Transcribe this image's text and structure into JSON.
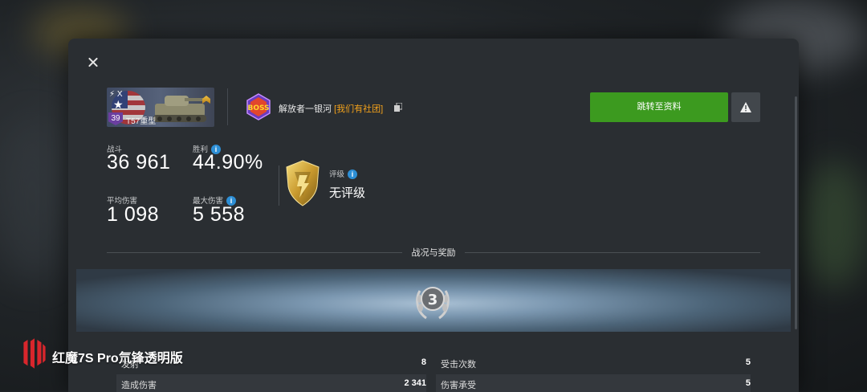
{
  "dialog": {
    "close_label": ""
  },
  "tank": {
    "tier_top": "X",
    "tier": "39",
    "name": "T57重型"
  },
  "player": {
    "name": "解放者一银河",
    "clan": "[我们有社团]",
    "boss_text": "BOSS"
  },
  "actions": {
    "goto_profile": "跳转至资料"
  },
  "stats": {
    "battles": {
      "label": "战斗",
      "value": "36 961"
    },
    "winrate": {
      "label": "胜利",
      "value": "44.90%"
    },
    "avg_damage": {
      "label": "平均伤害",
      "value": "1 098"
    },
    "max_damage": {
      "label": "最大伤害",
      "value": "5 558"
    }
  },
  "rating": {
    "label": "评级",
    "value": "无评级"
  },
  "section": {
    "title": "战况与奖励",
    "badge": "3"
  },
  "details": [
    {
      "label": "发射",
      "value": "8"
    },
    {
      "label": "受击次数",
      "value": "5"
    },
    {
      "label": "造成伤害",
      "value": "2 341"
    },
    {
      "label": "伤害承受",
      "value": "5"
    }
  ],
  "watermark": {
    "text": "红魔7S Pro氘锋透明版"
  },
  "colors": {
    "accent_green": "#3c9a1f",
    "clan_orange": "#f3a21b",
    "info_blue": "#2d8fd6"
  }
}
